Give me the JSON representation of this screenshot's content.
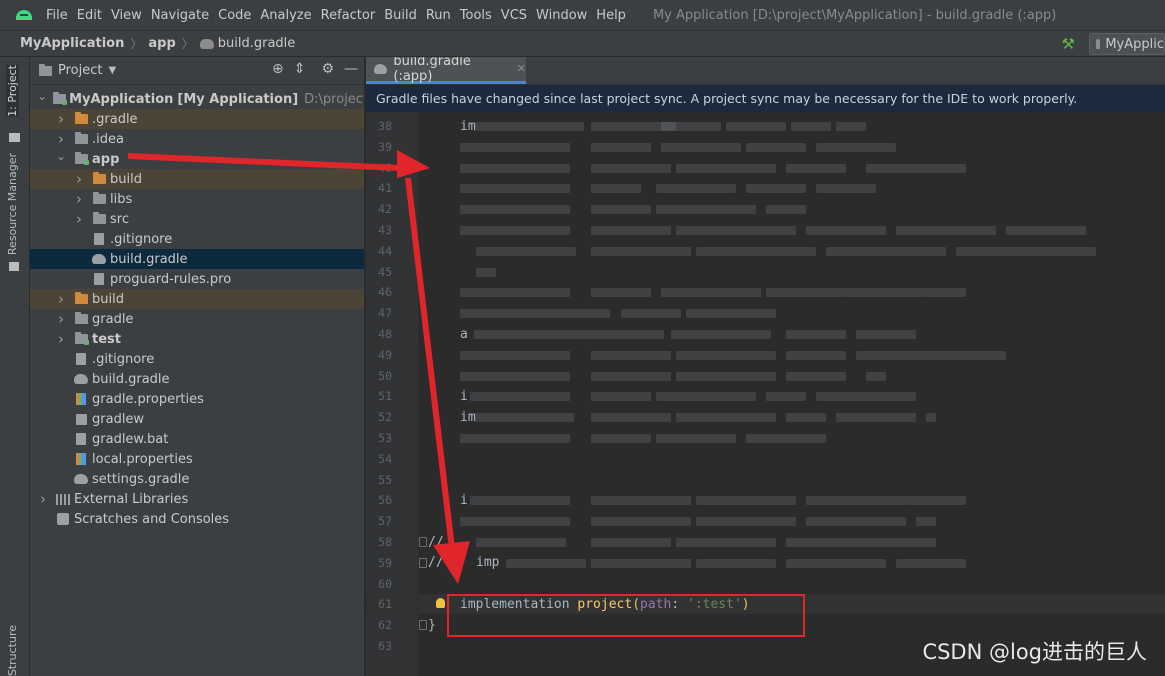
{
  "menubar": {
    "items": [
      "File",
      "Edit",
      "View",
      "Navigate",
      "Code",
      "Analyze",
      "Refactor",
      "Build",
      "Run",
      "Tools",
      "VCS",
      "Window",
      "Help"
    ],
    "window_title": "My Application [D:\\project\\MyApplication] - build.gradle (:app)"
  },
  "navbar": {
    "crumbs": [
      "MyApplication",
      "app",
      "build.gradle"
    ],
    "run_config": "MyApplic"
  },
  "toolstrip": {
    "project_tab": "1: Project",
    "resource_tab": "Resource Manager",
    "structure_tab": "Structure"
  },
  "project": {
    "title": "Project",
    "tree": [
      {
        "depth": 0,
        "arrow": "down",
        "icon": "module-folder-icon",
        "label": "MyApplication",
        "bold": true,
        "sub_bold": "[My Application]",
        "sub": "D:\\project\\MyApplication"
      },
      {
        "depth": 1,
        "arrow": "right",
        "icon": "orange-folder-icon",
        "label": ".gradle",
        "excluded": true
      },
      {
        "depth": 1,
        "arrow": "right",
        "icon": "folder-icon",
        "label": ".idea"
      },
      {
        "depth": 1,
        "arrow": "down",
        "icon": "module-folder-icon",
        "label": "app",
        "bold": true
      },
      {
        "depth": 2,
        "arrow": "right",
        "icon": "orange-folder-icon",
        "label": "build",
        "excluded": true
      },
      {
        "depth": 2,
        "arrow": "right",
        "icon": "folder-icon",
        "label": "libs"
      },
      {
        "depth": 2,
        "arrow": "right",
        "icon": "folder-icon",
        "label": "src"
      },
      {
        "depth": 2,
        "arrow": "",
        "icon": "gitignore-file-icon",
        "label": ".gitignore"
      },
      {
        "depth": 2,
        "arrow": "",
        "icon": "gradle-file-icon",
        "label": "build.gradle",
        "selected": true
      },
      {
        "depth": 2,
        "arrow": "",
        "icon": "text-file-icon",
        "label": "proguard-rules.pro"
      },
      {
        "depth": 1,
        "arrow": "right",
        "icon": "orange-folder-icon",
        "label": "build",
        "excluded": true
      },
      {
        "depth": 1,
        "arrow": "right",
        "icon": "folder-icon",
        "label": "gradle"
      },
      {
        "depth": 1,
        "arrow": "right",
        "icon": "module-folder-icon",
        "label": "test",
        "bold": true
      },
      {
        "depth": 1,
        "arrow": "",
        "icon": "gitignore-file-icon",
        "label": ".gitignore"
      },
      {
        "depth": 1,
        "arrow": "",
        "icon": "gradle-file-icon",
        "label": "build.gradle"
      },
      {
        "depth": 1,
        "arrow": "",
        "icon": "properties-file-icon",
        "label": "gradle.properties"
      },
      {
        "depth": 1,
        "arrow": "",
        "icon": "exec-file-icon",
        "label": "gradlew"
      },
      {
        "depth": 1,
        "arrow": "",
        "icon": "text-file-icon",
        "label": "gradlew.bat"
      },
      {
        "depth": 1,
        "arrow": "",
        "icon": "properties-file-icon",
        "label": "local.properties"
      },
      {
        "depth": 1,
        "arrow": "",
        "icon": "gradle-file-icon",
        "label": "settings.gradle"
      },
      {
        "depth": 0,
        "arrow": "right",
        "icon": "library-icon",
        "label": "External Libraries"
      },
      {
        "depth": 0,
        "arrow": "",
        "icon": "scratch-icon",
        "label": "Scratches and Consoles"
      }
    ]
  },
  "editor": {
    "tab_label": "build.gradle (:app)",
    "sync_banner": "Gradle files have changed since last project sync. A project sync may be necessary for the IDE to work properly.",
    "line_start": 38,
    "line_end": 63,
    "current_line": 61,
    "code_61": {
      "keyword": "implementation",
      "call": "project",
      "paren_open": "(",
      "param": "path",
      "colon": ": ",
      "string": "':test'",
      "paren_close": ")"
    },
    "code_62": "}",
    "code_58_prefix": "//",
    "code_59_prefix": "//",
    "code_59_visible": "imp",
    "code_38_visible": "im",
    "code_48_visible": "a",
    "code_51_visible": "i",
    "code_52_visible": "im",
    "code_56_visible": "i"
  },
  "watermark": "CSDN @log进击的巨人",
  "colors": {
    "arrow_red": "#e0262b",
    "highlight_red": "#e0262b",
    "selection_blue": "#0d293e",
    "banner_blue": "#1c2a3d"
  }
}
